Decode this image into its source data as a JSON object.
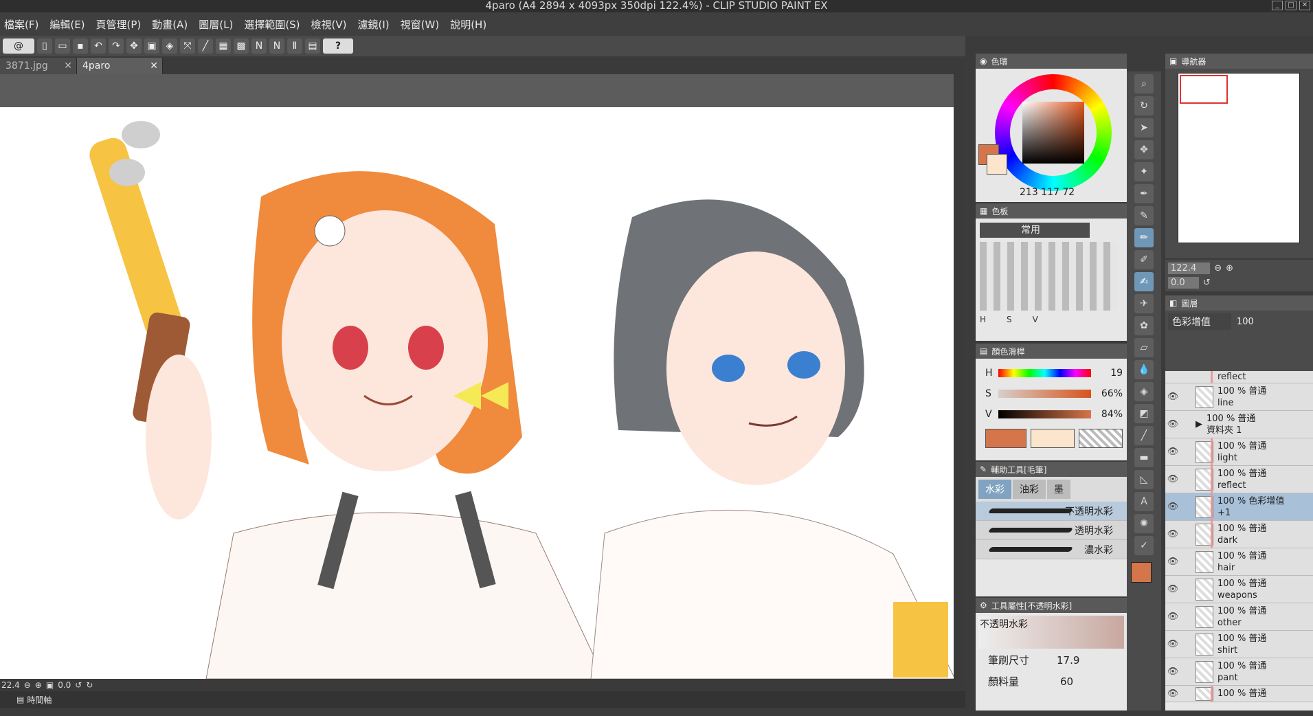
{
  "window": {
    "title": "4paro (A4 2894 x 4093px 350dpi 122.4%) - CLIP STUDIO PAINT EX"
  },
  "menu": [
    "檔案(F)",
    "編輯(E)",
    "頁管理(P)",
    "動畫(A)",
    "圖層(L)",
    "選擇範圍(S)",
    "檢視(V)",
    "濾鏡(I)",
    "視窗(W)",
    "說明(H)"
  ],
  "tabs": [
    {
      "label": "3871.jpg"
    },
    {
      "label": "4paro"
    }
  ],
  "status": {
    "zoom": "22.4",
    "angle": "0.0"
  },
  "timeline": {
    "label": "時間軸"
  },
  "color_wheel": {
    "title": "色環",
    "r": "213",
    "g": "117",
    "b": "72",
    "main_color": "#d5754a",
    "sub_color": "#fbe5cc"
  },
  "palette": {
    "title": "色板",
    "set": "常用",
    "h_label": "H",
    "s_label": "S",
    "v_label": "V"
  },
  "sliders": {
    "title": "顏色滑桿",
    "h": {
      "label": "H",
      "value": "19"
    },
    "s": {
      "label": "S",
      "value": "66%"
    },
    "v": {
      "label": "V",
      "value": "84%"
    }
  },
  "subtool": {
    "title": "輔助工具[毛筆]",
    "tabs": [
      "水彩",
      "油彩",
      "墨"
    ],
    "brushes": [
      "不透明水彩",
      "透明水彩",
      "濃水彩"
    ]
  },
  "tool_property": {
    "title": "工具屬性[不透明水彩]",
    "name": "不透明水彩",
    "size_label": "筆刷尺寸",
    "size_value": "17.9",
    "paint_label": "顏料量",
    "paint_value": "60"
  },
  "navigator": {
    "title": "導航器",
    "zoom": "122.4",
    "angle": "0.0"
  },
  "layers": {
    "title": "圖層",
    "blend": "色彩增值",
    "opacity": "100",
    "items": [
      {
        "mode": "",
        "name": "reflect"
      },
      {
        "mode": "100 % 普通",
        "name": "line"
      },
      {
        "mode": "100 % 普通",
        "name": "資料夾 1"
      },
      {
        "mode": "100 % 普通",
        "name": "light"
      },
      {
        "mode": "100 % 普通",
        "name": "reflect"
      },
      {
        "mode": "100 % 色彩增值",
        "name": "+1"
      },
      {
        "mode": "100 % 普通",
        "name": "dark"
      },
      {
        "mode": "100 % 普通",
        "name": "hair"
      },
      {
        "mode": "100 % 普通",
        "name": "weapons"
      },
      {
        "mode": "100 % 普通",
        "name": "other"
      },
      {
        "mode": "100 % 普通",
        "name": "shirt"
      },
      {
        "mode": "100 % 普通",
        "name": "pant"
      },
      {
        "mode": "100 % 普通",
        "name": ""
      }
    ]
  }
}
